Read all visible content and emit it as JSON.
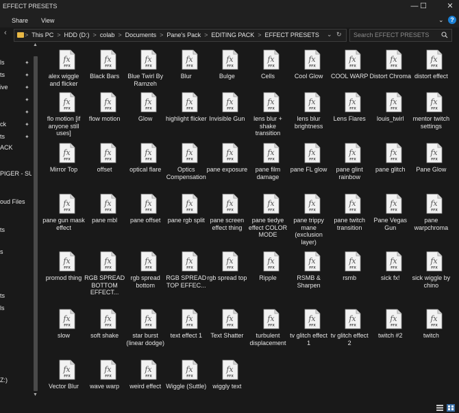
{
  "window": {
    "title": "EFFECT PRESETS"
  },
  "window_controls": {
    "minimize": "—",
    "maximize": "☐",
    "close": "✕"
  },
  "ribbon": {
    "tabs": [
      "Share",
      "View"
    ],
    "expand": "⌄",
    "help": "?"
  },
  "address": {
    "crumbs": [
      "This PC",
      "HDD (D:)",
      "colab",
      "Documents",
      "Pane's Pack",
      "EDITING PACK",
      "EFFECT PRESETS"
    ],
    "separator": ">",
    "back_glyph": "‹",
    "dropdown": "⌄",
    "refresh": "↻"
  },
  "search": {
    "placeholder": "Search EFFECT PRESETS",
    "value": ""
  },
  "nav_pane": {
    "pin_glyph": "✦",
    "items": [
      {
        "label": "ls",
        "pinned": true
      },
      {
        "label": "ts",
        "pinned": true
      },
      {
        "label": "ive",
        "pinned": true
      },
      {
        "label": "",
        "pinned": true
      },
      {
        "label": "",
        "pinned": true
      },
      {
        "label": "ck",
        "pinned": true
      },
      {
        "label": "ts",
        "pinned": true
      },
      {
        "label": "ACK",
        "pinned": false
      },
      {
        "label": "PIGER - SUP",
        "pinned": false
      },
      {
        "label": "oud Files",
        "pinned": false
      },
      {
        "label": "ts",
        "pinned": false
      },
      {
        "label": "s",
        "pinned": false
      },
      {
        "label": "ts",
        "pinned": false
      },
      {
        "label": "ls",
        "pinned": false
      },
      {
        "label": "Z:)",
        "pinned": false
      }
    ]
  },
  "files": {
    "icon_badge": "fx",
    "icon_sub": "FFX",
    "items": [
      "alex wiggle and flicker",
      "Black Bars",
      "Blue Twirl By Ramzeh",
      "Blur",
      "Bulge",
      "Cells",
      "Cool Glow",
      "COOL WARP",
      "Distort Chroma",
      "distort effect",
      "flo motion [if anyone still uses]",
      "flow motion",
      "Glow",
      "highlight flicker",
      "Invisible Gun",
      "lens blur + shake transition",
      "lens blur brightness",
      "Lens Flares",
      "louis_twirl",
      "mentor twitch settings",
      "Mirror Top",
      "offset",
      "optical flare",
      "Optics Compensation",
      "pane exposure",
      "pane film damage",
      "pane FL glow",
      "pane glint rainbow",
      "pane glitch",
      "Pane Glow",
      "pane gun mask effect",
      "pane mbl",
      "pane offset",
      "pane rgb split",
      "pane screen effect thing",
      "pane tiedye effect COLOR MODE",
      "pane trippy mane (exclusion layer)",
      "pane twitch transition",
      "Pane Vegas Gun",
      "pane warpchroma",
      "promod thing",
      "RGB SPREAD BOTTOM EFFECT...",
      "rgb spread bottom",
      "RGB SPREAD TOP EFFEC...",
      "rgb spread top",
      "Ripple",
      "RSMB & Sharpen",
      "rsmb",
      "sick fx!",
      "sick wiggle by chino",
      "slow",
      "soft shake",
      "star burst (linear dodge)",
      "text effect 1",
      "Text Shatter",
      "turbulent displacement",
      "tv glitch effect 1",
      "tv glitch effect 2",
      "twitch #2",
      "twitch",
      "Vector Blur",
      "wave warp",
      "weird effect",
      "Wiggle (Suttle)",
      "wiggly text"
    ]
  },
  "scrollbar": {
    "up": "▲",
    "down": "▼"
  },
  "colors": {
    "background": "#191919",
    "chrome": "#202020",
    "folder": "#e8b845",
    "accent": "#1a7fd4",
    "icon_page": "#f2f2f2"
  }
}
